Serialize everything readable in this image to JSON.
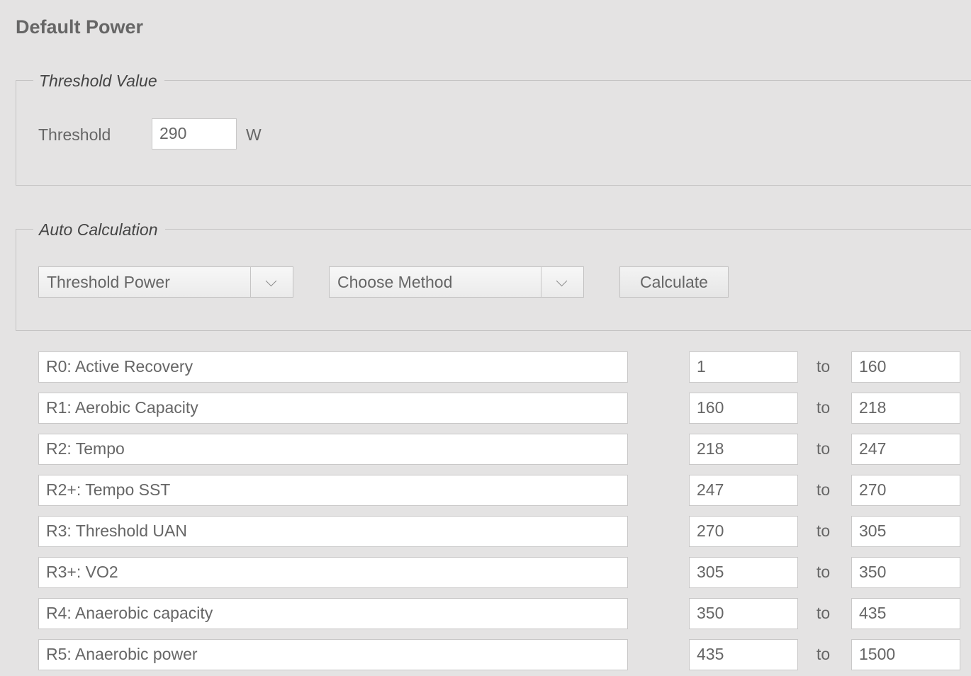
{
  "page": {
    "title": "Default Power"
  },
  "threshold_panel": {
    "legend": "Threshold Value",
    "label": "Threshold",
    "value": "290",
    "unit": "W"
  },
  "auto_panel": {
    "legend": "Auto Calculation",
    "type_select": "Threshold Power",
    "method_select": "Choose Method",
    "calculate_label": "Calculate"
  },
  "zones": [
    {
      "name": "R0: Active Recovery",
      "from": "1",
      "sep": "to",
      "to": "160"
    },
    {
      "name": "R1: Aerobic Capacity",
      "from": "160",
      "sep": "to",
      "to": "218"
    },
    {
      "name": "R2: Tempo",
      "from": "218",
      "sep": "to",
      "to": "247"
    },
    {
      "name": "R2+: Tempo SST",
      "from": "247",
      "sep": "to",
      "to": "270"
    },
    {
      "name": "R3: Threshold UAN",
      "from": "270",
      "sep": "to",
      "to": "305"
    },
    {
      "name": "R3+: VO2",
      "from": "305",
      "sep": "to",
      "to": "350"
    },
    {
      "name": "R4: Anaerobic capacity",
      "from": "350",
      "sep": "to",
      "to": "435"
    },
    {
      "name": "R5: Anaerobic power",
      "from": "435",
      "sep": "to",
      "to": "1500"
    }
  ]
}
